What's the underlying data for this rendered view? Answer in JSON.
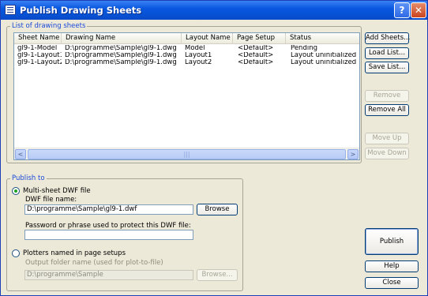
{
  "window": {
    "title": "Publish Drawing Sheets",
    "help_glyph": "?",
    "close_glyph": "✕"
  },
  "sheet_list": {
    "group_label": "List of drawing sheets",
    "columns": [
      "Sheet Name",
      "Drawing Name",
      "Layout Name",
      "Page Setup",
      "Status"
    ],
    "rows": [
      {
        "sheet": "gl9-1-Model",
        "drawing": "D:\\programme\\Sample\\gl9-1.dwg",
        "layout": "Model",
        "setup": "<Default>",
        "status": "Pending"
      },
      {
        "sheet": "gl9-1-Layout1",
        "drawing": "D:\\programme\\Sample\\gl9-1.dwg",
        "layout": "Layout1",
        "setup": "<Default>",
        "status": "Layout uninitialized"
      },
      {
        "sheet": "gl9-1-Layout2",
        "drawing": "D:\\programme\\Sample\\gl9-1.dwg",
        "layout": "Layout2",
        "setup": "<Default>",
        "status": "Layout uninitialized"
      }
    ],
    "scroll_left": "<",
    "scroll_right": ">",
    "scroll_grip": "|||"
  },
  "side_buttons": {
    "add_sheets": "Add Sheets...",
    "load_list": "Load List...",
    "save_list": "Save List...",
    "remove": "Remove",
    "remove_all": "Remove All",
    "move_up": "Move Up",
    "move_down": "Move Down"
  },
  "publish_to": {
    "group_label": "Publish to",
    "multi_sheet_label": "Multi-sheet DWF file",
    "dwf_filename_label": "DWF file name:",
    "dwf_filename_value": "D:\\programme\\Sample\\gl9-1.dwf",
    "browse_label": "Browse",
    "password_label": "Password or phrase used to protect this DWF file:",
    "password_value": "",
    "plotters_label": "Plotters named in page setups",
    "output_folder_label": "Output folder name (used for plot-to-file)",
    "output_folder_value": "D:\\programme\\Sample",
    "browse_disabled_label": "Browse..."
  },
  "actions": {
    "publish": "Publish",
    "help": "Help",
    "close": "Close"
  }
}
